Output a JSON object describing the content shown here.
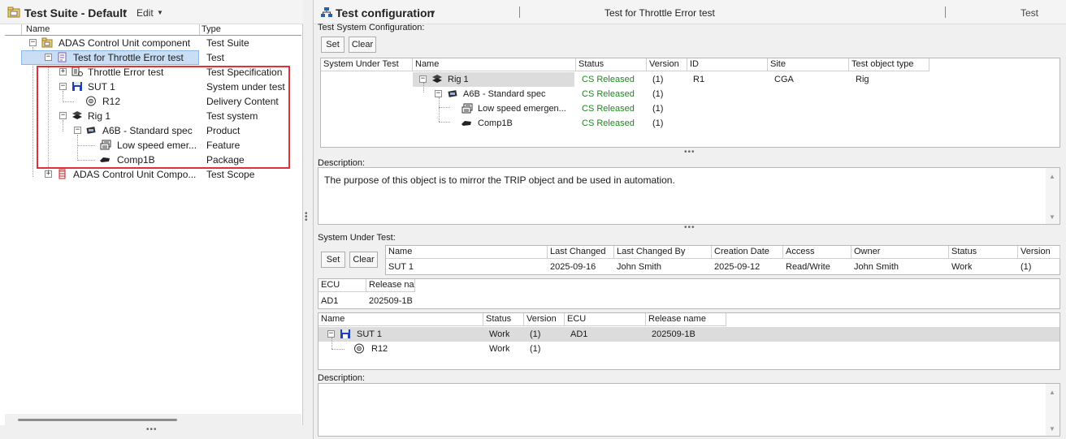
{
  "left": {
    "title": "Test Suite - Default",
    "edit_label": "Edit",
    "columns": {
      "name": "Name",
      "type": "Type"
    },
    "tree": [
      {
        "name": "ADAS Control Unit component",
        "type": "Test Suite",
        "icon": "test-suite-icon",
        "expander": "minus"
      },
      {
        "name": "Test for Throttle Error test",
        "type": "Test",
        "icon": "test-icon",
        "expander": "minus",
        "selected": true
      },
      {
        "name": "Throttle Error test",
        "type": "Test Specification",
        "icon": "test-specification-icon",
        "expander": "plus"
      },
      {
        "name": "SUT 1",
        "type": "System under test",
        "icon": "floppy-disk-icon",
        "expander": "minus"
      },
      {
        "name": "R12",
        "type": "Delivery Content",
        "icon": "target-icon"
      },
      {
        "name": "Rig 1",
        "type": "Test system",
        "icon": "rig-icon",
        "expander": "minus"
      },
      {
        "name": "A6B - Standard spec",
        "type": "Product",
        "icon": "product-icon",
        "expander": "minus"
      },
      {
        "name": "Low speed emer...",
        "type": "Feature",
        "icon": "feature-icon"
      },
      {
        "name": "Comp1B",
        "type": "Package",
        "icon": "package-icon"
      },
      {
        "name": "ADAS Control Unit Compo...",
        "type": "Test Scope",
        "icon": "test-scope-icon",
        "expander": "plus"
      }
    ],
    "highlight_color": "#e0303b"
  },
  "right": {
    "title": "Test configuration",
    "object_name": "Test for Throttle Error test",
    "object_type": "Test",
    "tsc": {
      "label": "Test System Configuration:",
      "set_label": "Set",
      "clear_label": "Clear",
      "columns": [
        "System Under Test",
        "Name",
        "Status",
        "Version",
        "ID",
        "Site",
        "Test object type"
      ],
      "rows": [
        {
          "name": "Rig 1",
          "status": "CS Released",
          "version": "(1)",
          "id": "R1",
          "site": "CGA",
          "type": "Rig"
        },
        {
          "name": "A6B - Standard spec",
          "status": "CS Released",
          "version": "(1)",
          "id": "",
          "site": "",
          "type": ""
        },
        {
          "name": "Low speed emergen...",
          "status": "CS Released",
          "version": "(1)",
          "id": "",
          "site": "",
          "type": ""
        },
        {
          "name": "Comp1B",
          "status": "CS Released",
          "version": "(1)",
          "id": "",
          "site": "",
          "type": ""
        }
      ]
    },
    "description1": {
      "label": "Description:",
      "text": "The purpose of this object is to mirror the TRIP object and be used in automation."
    },
    "sut": {
      "label": "System Under Test:",
      "set_label": "Set",
      "clear_label": "Clear",
      "columns": [
        "Name",
        "Last Changed",
        "Last Changed By",
        "Creation Date",
        "Access",
        "Owner",
        "Status",
        "Version"
      ],
      "row": [
        "SUT 1",
        "2025-09-16",
        "John Smith",
        "2025-09-12",
        "Read/Write",
        "John Smith",
        "Work",
        "(1)"
      ],
      "ecu_columns": [
        "ECU",
        "Release na"
      ],
      "ecu_row": [
        "AD1",
        "202509-1B"
      ]
    },
    "sut_tree": {
      "columns": [
        "Name",
        "Status",
        "Version",
        "ECU",
        "Release name"
      ],
      "rows": [
        {
          "name": "SUT 1",
          "status": "Work",
          "version": "(1)",
          "ecu": "AD1",
          "release": "202509-1B"
        },
        {
          "name": "R12",
          "status": "Work",
          "version": "(1)",
          "ecu": "",
          "release": ""
        }
      ]
    },
    "description2": {
      "label": "Description:",
      "text": ""
    }
  },
  "colors": {
    "status_released": "#1a8a1a",
    "selection": "#c9def5"
  }
}
